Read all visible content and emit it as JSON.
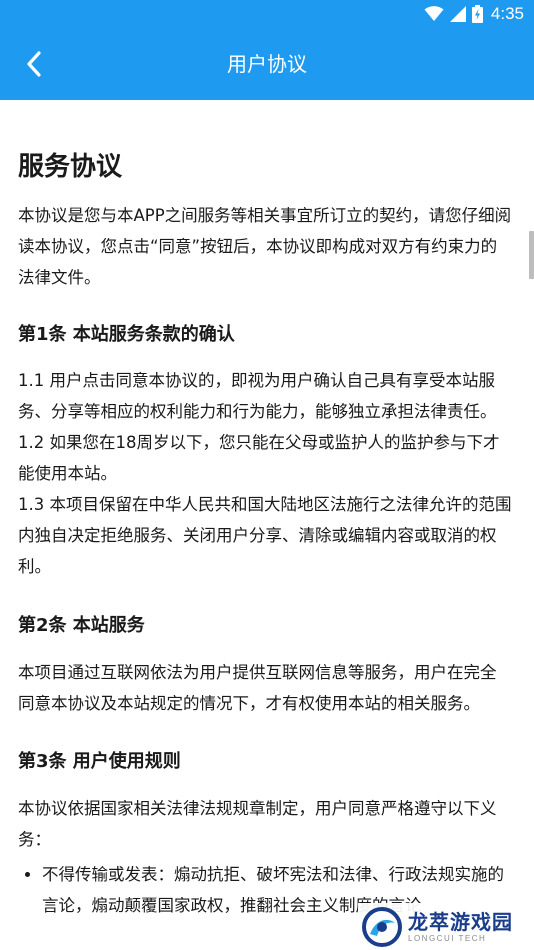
{
  "status_bar": {
    "time": "4:35",
    "icons": [
      "wifi-icon",
      "signal-icon",
      "battery-icon"
    ]
  },
  "app_bar": {
    "title": "用户协议",
    "back_icon": "chevron-left-icon",
    "background": "#1e9bf0"
  },
  "document": {
    "title": "服务协议",
    "intro": "本协议是您与本APP之间服务等相关事宜所订立的契约，请您仔细阅读本协议，您点击“同意”按钮后，本协议即构成对双方有约束力的法律文件。",
    "sections": [
      {
        "heading": "第1条 本站服务条款的确认",
        "paragraphs": [
          "1.1 用户点击同意本协议的，即视为用户确认自己具有享受本站服务、分享等相应的权利能力和行为能力，能够独立承担法律责任。",
          "1.2 如果您在18周岁以下，您只能在父母或监护人的监护参与下才能使用本站。",
          "1.3 本项目保留在中华人民共和国大陆地区法施行之法律允许的范围内独自决定拒绝服务、关闭用户分享、清除或编辑内容或取消的权利。"
        ]
      },
      {
        "heading": "第2条 本站服务",
        "paragraphs": [
          "本项目通过互联网依法为用户提供互联网信息等服务，用户在完全同意本协议及本站规定的情况下，才有权使用本站的相关服务。"
        ]
      },
      {
        "heading": "第3条 用户使用规则",
        "paragraphs": [
          "本协议依据国家相关法律法规规章制定，用户同意严格遵守以下义务："
        ],
        "list": [
          "不得传输或发表：煽动抗拒、破坏宪法和法律、行政法规实施的言论，煽动颠覆国家政权，推翻社会主义制度的言论"
        ]
      }
    ]
  },
  "watermark": {
    "name": "龙萃游戏园",
    "name_en": "LONGCUI TECH"
  }
}
